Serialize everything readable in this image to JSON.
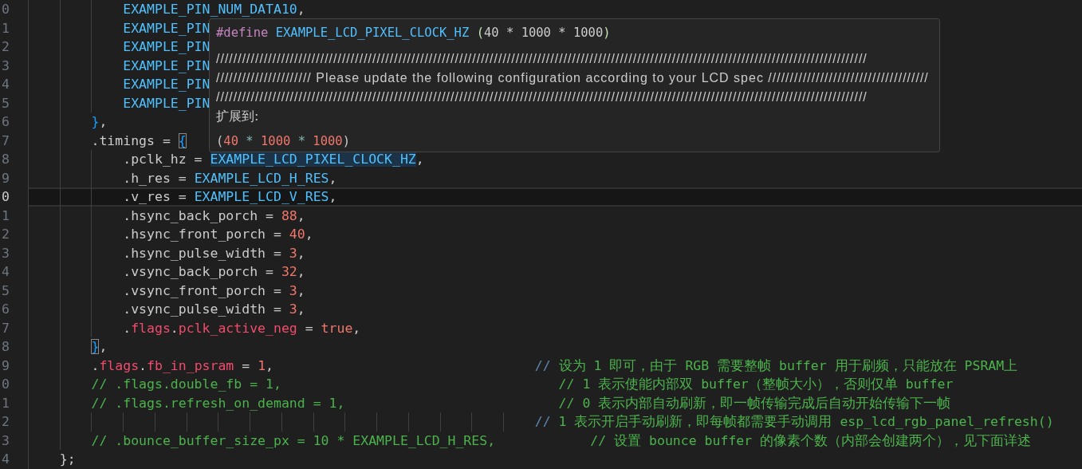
{
  "editor": {
    "lines": [
      {
        "number": "0",
        "current": false,
        "tokens": [
          {
            "text": "            EXAMPLE_PIN_NUM_DATA10",
            "kind": "macro"
          },
          {
            "text": ",",
            "kind": "plain"
          }
        ]
      },
      {
        "number": "1",
        "current": false,
        "tokens": [
          {
            "text": "            EXAMPLE_PIN",
            "kind": "macro"
          }
        ]
      },
      {
        "number": "2",
        "current": false,
        "tokens": [
          {
            "text": "            EXAMPLE_PIN",
            "kind": "macro"
          }
        ]
      },
      {
        "number": "3",
        "current": false,
        "tokens": [
          {
            "text": "            EXAMPLE_PIN",
            "kind": "macro"
          }
        ]
      },
      {
        "number": "4",
        "current": false,
        "tokens": [
          {
            "text": "            EXAMPLE_PIN",
            "kind": "macro"
          }
        ]
      },
      {
        "number": "5",
        "current": false,
        "tokens": [
          {
            "text": "            EXAMPLE_PIN",
            "kind": "macro"
          }
        ]
      },
      {
        "number": "6",
        "current": false,
        "tokens": [
          {
            "text": "        }",
            "kind": "bracket",
            "matched": false
          },
          {
            "text": ",",
            "kind": "plain"
          }
        ]
      },
      {
        "number": "7",
        "current": false,
        "tokens": [
          {
            "text": "        .timings = ",
            "kind": "plain"
          },
          {
            "text": "{",
            "kind": "bracket",
            "matched": true
          }
        ]
      },
      {
        "number": "8",
        "current": false,
        "tokens": [
          {
            "text": "            .pclk_hz = ",
            "kind": "plain"
          },
          {
            "text": "EXAMPLE_LCD_PIXEL_CLOCK_HZ",
            "kind": "macro",
            "highlighted": true
          },
          {
            "text": ",",
            "kind": "plain"
          }
        ]
      },
      {
        "number": "9",
        "current": false,
        "tokens": [
          {
            "text": "            .h_res = ",
            "kind": "plain"
          },
          {
            "text": "EXAMPLE_LCD_H_RES",
            "kind": "macro"
          },
          {
            "text": ",",
            "kind": "plain"
          }
        ]
      },
      {
        "number": "0",
        "current": true,
        "tokens": [
          {
            "text": "            .v_res = ",
            "kind": "plain"
          },
          {
            "text": "EXAMPLE_LCD_V_RES",
            "kind": "macro"
          },
          {
            "text": ",",
            "kind": "plain"
          }
        ]
      },
      {
        "number": "1",
        "current": false,
        "tokens": [
          {
            "text": "            .hsync_back_porch = ",
            "kind": "plain"
          },
          {
            "text": "88",
            "kind": "number"
          },
          {
            "text": ",",
            "kind": "plain"
          }
        ]
      },
      {
        "number": "2",
        "current": false,
        "tokens": [
          {
            "text": "            .hsync_front_porch = ",
            "kind": "plain"
          },
          {
            "text": "40",
            "kind": "number"
          },
          {
            "text": ",",
            "kind": "plain"
          }
        ]
      },
      {
        "number": "3",
        "current": false,
        "tokens": [
          {
            "text": "            .hsync_pulse_width = ",
            "kind": "plain"
          },
          {
            "text": "3",
            "kind": "number"
          },
          {
            "text": ",",
            "kind": "plain"
          }
        ]
      },
      {
        "number": "4",
        "current": false,
        "tokens": [
          {
            "text": "            .vsync_back_porch = ",
            "kind": "plain"
          },
          {
            "text": "32",
            "kind": "number"
          },
          {
            "text": ",",
            "kind": "plain"
          }
        ]
      },
      {
        "number": "5",
        "current": false,
        "tokens": [
          {
            "text": "            .vsync_front_porch = ",
            "kind": "plain"
          },
          {
            "text": "3",
            "kind": "number"
          },
          {
            "text": ",",
            "kind": "plain"
          }
        ]
      },
      {
        "number": "6",
        "current": false,
        "tokens": [
          {
            "text": "            .vsync_pulse_width = ",
            "kind": "plain"
          },
          {
            "text": "3",
            "kind": "number"
          },
          {
            "text": ",",
            "kind": "plain"
          }
        ]
      },
      {
        "number": "7",
        "current": false,
        "tokens": [
          {
            "text": "            .",
            "kind": "plain"
          },
          {
            "text": "flags",
            "kind": "flag"
          },
          {
            "text": ".",
            "kind": "plain"
          },
          {
            "text": "pclk_active_neg",
            "kind": "flag"
          },
          {
            "text": " = ",
            "kind": "plain"
          },
          {
            "text": "true",
            "kind": "number"
          },
          {
            "text": ",",
            "kind": "plain"
          }
        ]
      },
      {
        "number": "8",
        "current": false,
        "tokens": [
          {
            "text": "        }",
            "kind": "bracket",
            "matched": true
          },
          {
            "text": ",",
            "kind": "plain"
          }
        ]
      },
      {
        "number": "9",
        "current": false,
        "tokens": [
          {
            "text": "        .",
            "kind": "plain"
          },
          {
            "text": "flags",
            "kind": "flag"
          },
          {
            "text": ".",
            "kind": "plain"
          },
          {
            "text": "fb_in_psram",
            "kind": "flag"
          },
          {
            "text": " = ",
            "kind": "plain"
          },
          {
            "text": "1",
            "kind": "number"
          },
          {
            "text": ",                                 ",
            "kind": "plain"
          },
          {
            "text": "//",
            "kind": "comment_mark"
          },
          {
            "text": " 设为 1 即可，由于 RGB 需要整帧 buffer 用于刷频，只能放在 PSRAM上",
            "kind": "comment"
          }
        ]
      },
      {
        "number": "0",
        "current": false,
        "tokens": [
          {
            "text": "        // .flags.double_fb = 1,                                   // 1 表示使能内部双 buffer（整帧大小），否则仅单 buffer",
            "kind": "comment"
          }
        ]
      },
      {
        "number": "1",
        "current": false,
        "tokens": [
          {
            "text": "        // .flags.refresh_on_demand = 1,                           // 0 表示内部自动刷新，即一帧传输完成后自动开始传输下一帧",
            "kind": "comment"
          }
        ]
      },
      {
        "number": "2",
        "current": false,
        "tokens": [
          {
            "text": "                                                                //",
            "kind": "comment_mark"
          },
          {
            "text": " 1 表示开启手动刷新，即每帧都需要手动调用 esp_lcd_rgb_panel_refresh()",
            "kind": "comment"
          }
        ]
      },
      {
        "number": "3",
        "current": false,
        "tokens": [
          {
            "text": "        // .bounce_buffer_size_px = 10 * EXAMPLE_LCD_H_RES,            // 设置 bounce buffer 的像素个数（内部会创建两个），见下面详述",
            "kind": "comment"
          }
        ]
      },
      {
        "number": "4",
        "current": false,
        "tokens": [
          {
            "text": "    };",
            "kind": "plain"
          }
        ]
      }
    ]
  },
  "hover": {
    "signature": [
      {
        "text": "#define",
        "kind": "directive"
      },
      {
        "text": " EXAMPLE_LCD_PIXEL_CLOCK_HZ",
        "kind": "macro"
      },
      {
        "text": " (",
        "kind": "paren"
      },
      {
        "text": "40 * 1000 * 1000",
        "kind": "plain"
      },
      {
        "text": ")",
        "kind": "paren"
      }
    ],
    "doc_lines": [
      "//////////////////////////////////////////////////////////////////////////////////////////////////////////////////////////////////////////////////////",
      "////////////////////// Please update the following configuration according to your LCD spec /////////////////////////////////////",
      "//////////////////////////////////////////////////////////////////////////////////////////////////////////////////////////////////////////////////////"
    ],
    "expands_label": "扩展到:",
    "expansion": [
      {
        "text": "(",
        "kind": "plain"
      },
      {
        "text": "40",
        "kind": "number"
      },
      {
        "text": " * ",
        "kind": "operator"
      },
      {
        "text": "1000",
        "kind": "number"
      },
      {
        "text": " * ",
        "kind": "operator"
      },
      {
        "text": "1000",
        "kind": "number"
      },
      {
        "text": ")",
        "kind": "plain"
      }
    ]
  }
}
